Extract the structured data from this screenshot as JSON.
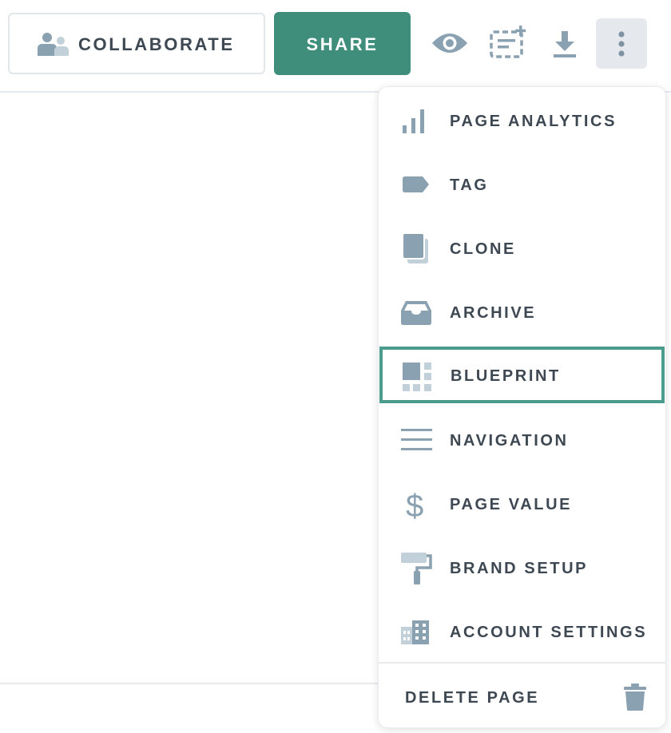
{
  "toolbar": {
    "collaborate_label": "COLLABORATE",
    "share_label": "SHARE",
    "icons": [
      "preview-eye-icon",
      "add-to-collection-icon",
      "download-icon",
      "more-vertical-icon"
    ]
  },
  "menu": {
    "items": [
      {
        "label": "PAGE ANALYTICS",
        "icon": "bar-chart-icon"
      },
      {
        "label": "TAG",
        "icon": "tag-icon"
      },
      {
        "label": "CLONE",
        "icon": "clone-icon"
      },
      {
        "label": "ARCHIVE",
        "icon": "archive-icon"
      },
      {
        "label": "BLUEPRINT",
        "icon": "blueprint-grid-icon",
        "selected": true
      },
      {
        "label": "NAVIGATION",
        "icon": "navigation-lines-icon"
      },
      {
        "label": "PAGE VALUE",
        "icon": "dollar-icon"
      },
      {
        "label": "BRAND SETUP",
        "icon": "paint-roller-icon"
      },
      {
        "label": "ACCOUNT SETTINGS",
        "icon": "building-icon"
      }
    ],
    "delete_label": "DELETE PAGE",
    "delete_icon": "trash-icon"
  },
  "colors": {
    "accent": "#3f8d7b",
    "selected_border": "#4a9c8c",
    "text": "#3e4852",
    "icon": "#8aa1b1",
    "icon_light": "#c2d0d9"
  }
}
